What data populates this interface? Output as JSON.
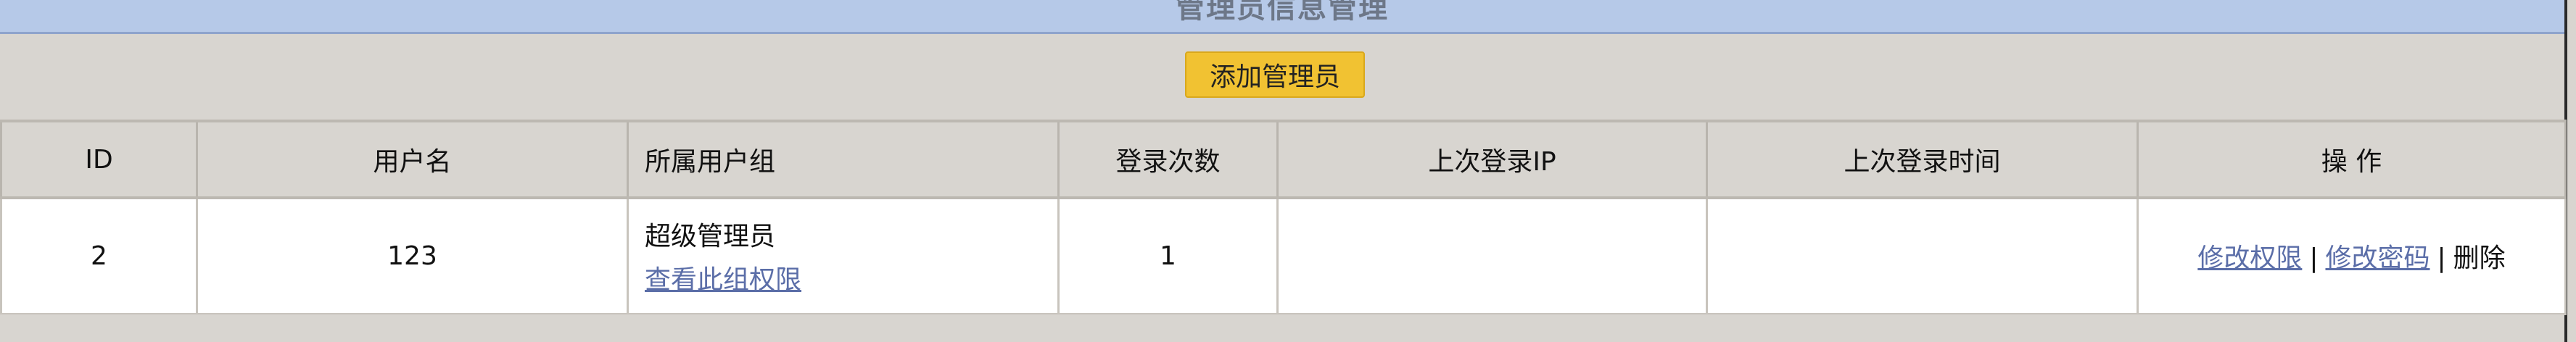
{
  "header": {
    "title": "管理员信息管理"
  },
  "toolbar": {
    "add_label": "添加管理员"
  },
  "table": {
    "columns": [
      "ID",
      "用户名",
      "所属用户组",
      "登录次数",
      "上次登录IP",
      "上次登录时间",
      "操 作"
    ],
    "rows": [
      {
        "id": "2",
        "username": "123",
        "group": "超级管理员",
        "group_link": "查看此组权限",
        "login_count": "1",
        "last_ip": "",
        "last_time": "",
        "ops": {
          "edit_perm": "修改权限",
          "sep": "|",
          "edit_pwd": "修改密码",
          "delete": "删除"
        }
      }
    ]
  },
  "colors": {
    "title_bar": "#b6c9e8",
    "button": "#f1c232",
    "link": "#5b6ea8",
    "background": "#d8d5d0"
  }
}
